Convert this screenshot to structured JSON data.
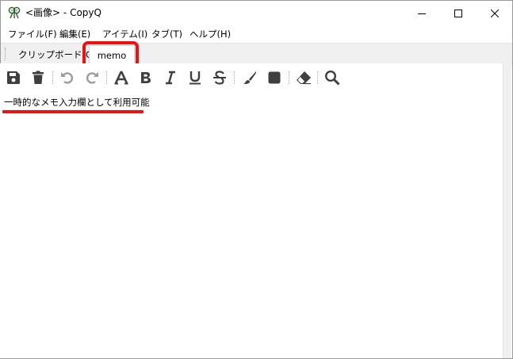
{
  "window": {
    "title": "<画像> - CopyQ",
    "controls": {
      "minimize_icon": "minimize-icon",
      "maximize_icon": "maximize-icon",
      "close_icon": "close-icon"
    }
  },
  "menubar": {
    "items": [
      {
        "label": "ファイル(F)"
      },
      {
        "label": "編集(E)"
      },
      {
        "label": "アイテム(I)"
      },
      {
        "label": "タブ(T)"
      },
      {
        "label": "ヘルプ(H)"
      }
    ]
  },
  "tabs": {
    "items": [
      {
        "label": "クリップボード(C)",
        "active": false
      },
      {
        "label": "memo",
        "active": true
      }
    ]
  },
  "toolbar": {
    "items": [
      "save-icon",
      "delete-icon",
      "undo-icon",
      "redo-icon",
      "font-icon",
      "bold-icon",
      "italic-icon",
      "underline-icon",
      "strikethrough-icon",
      "foreground-color-icon",
      "background-color-icon",
      "erase-style-icon",
      "search-icon"
    ]
  },
  "editor": {
    "text": "一時的なメモ入力欄として利用可能"
  },
  "annotation": {
    "highlight_color": "#ee1111"
  }
}
